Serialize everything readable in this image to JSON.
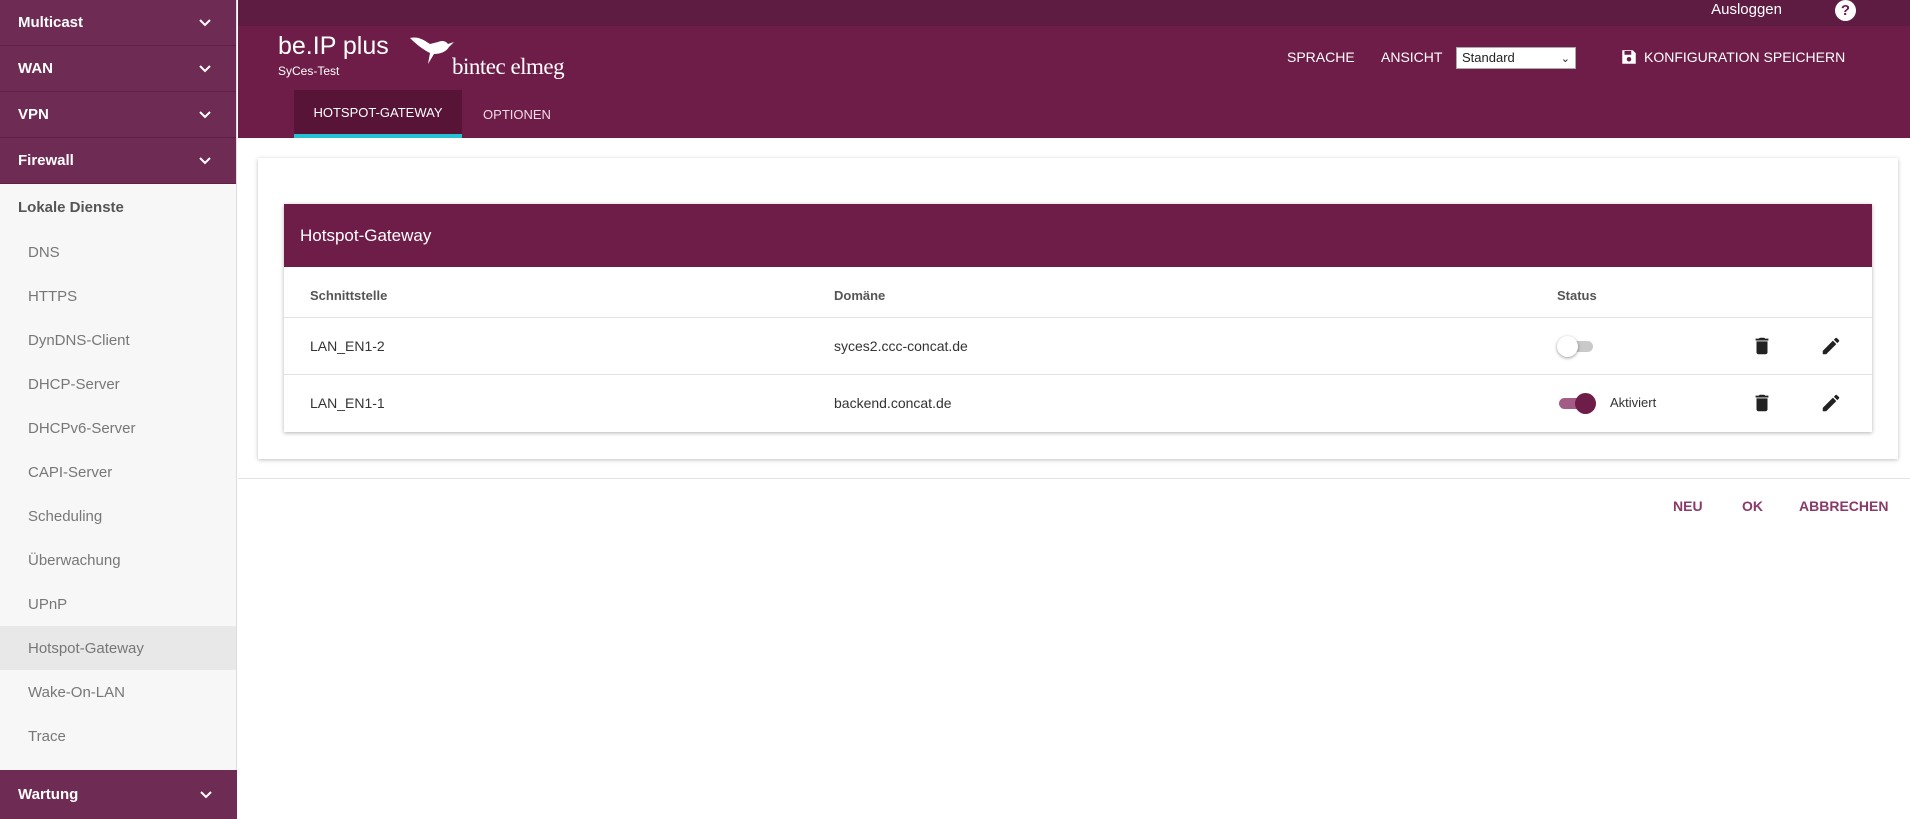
{
  "sidebar": {
    "groups_top": [
      {
        "label": "Multicast"
      },
      {
        "label": "WAN"
      },
      {
        "label": "VPN"
      },
      {
        "label": "Firewall"
      }
    ],
    "section_label": "Lokale Dienste",
    "items": [
      {
        "label": "DNS"
      },
      {
        "label": "HTTPS"
      },
      {
        "label": "DynDNS-Client"
      },
      {
        "label": "DHCP-Server"
      },
      {
        "label": "DHCPv6-Server"
      },
      {
        "label": "CAPI-Server"
      },
      {
        "label": "Scheduling"
      },
      {
        "label": "Überwachung"
      },
      {
        "label": "UPnP"
      },
      {
        "label": "Hotspot-Gateway"
      },
      {
        "label": "Wake-On-LAN"
      },
      {
        "label": "Trace"
      }
    ],
    "active_item": "Hotspot-Gateway",
    "group_bottom": {
      "label": "Wartung"
    }
  },
  "header": {
    "title": "be.IP plus",
    "subtitle": "SyCes-Test",
    "logo_text": "bintec elmeg",
    "logout": "Ausloggen",
    "help": "?",
    "language": "SPRACHE",
    "view_label": "ANSICHT",
    "view_selected": "Standard",
    "save_config": "KONFIGURATION SPEICHERN",
    "tabs": [
      {
        "label": "HOTSPOT-GATEWAY",
        "active": true
      },
      {
        "label": "OPTIONEN",
        "active": false
      }
    ]
  },
  "panel": {
    "title": "Hotspot-Gateway",
    "columns": {
      "interface": "Schnittstelle",
      "domain": "Domäne",
      "status": "Status"
    },
    "rows": [
      {
        "interface": "LAN_EN1-2",
        "domain": "syces2.ccc-concat.de",
        "enabled": false,
        "status_text": ""
      },
      {
        "interface": "LAN_EN1-1",
        "domain": "backend.concat.de",
        "enabled": true,
        "status_text": "Aktiviert"
      }
    ]
  },
  "actions": {
    "new": "NEU",
    "ok": "OK",
    "cancel": "ABBRECHEN"
  },
  "colors": {
    "brand": "#6e1d48",
    "tab_indicator": "#26c1d4",
    "action_text": "#8a3a67"
  }
}
